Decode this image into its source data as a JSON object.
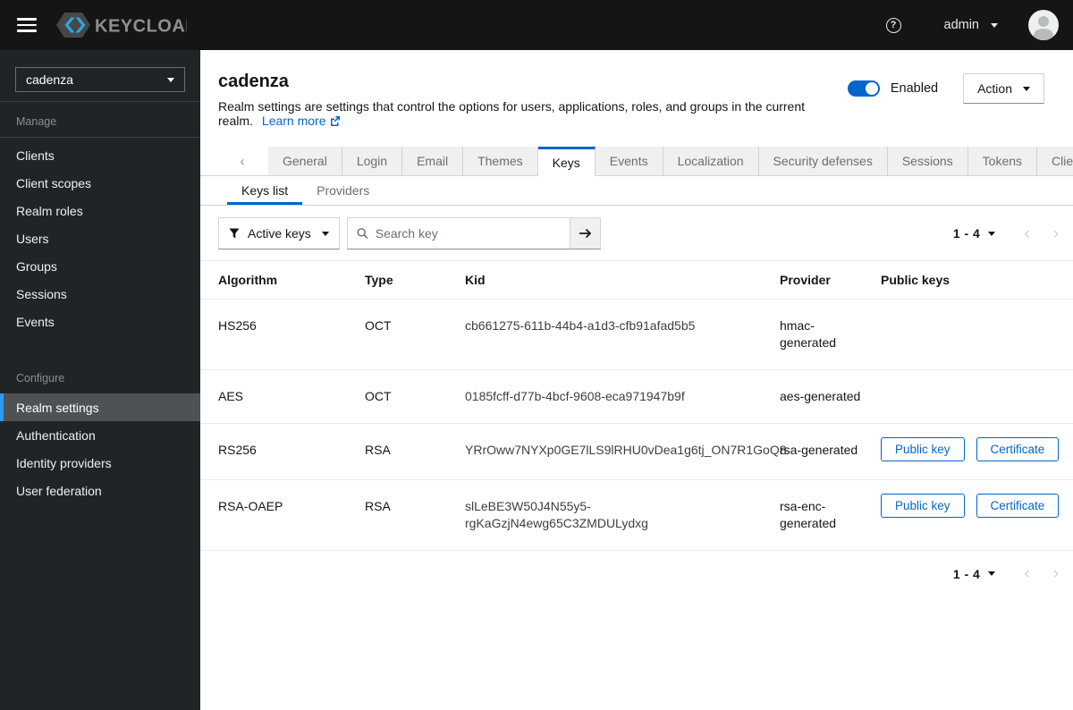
{
  "colors": {
    "accent": "#0066cc",
    "brand_cyan": "#29abe2",
    "topbar_bg": "#151515",
    "sidebar_bg": "#212427",
    "selected_nav_bg": "#4f5255",
    "selected_nav_accent": "#2b9af3",
    "tab_inactive_bg": "#f0f0f0",
    "disabled_gray": "#d2d2d2"
  },
  "topbar": {
    "brand": "KEYCLOAK",
    "help_icon": "?",
    "username": "admin"
  },
  "sidebar": {
    "realm_selector": "cadenza",
    "sections": [
      {
        "title": "Manage",
        "items": [
          "Clients",
          "Client scopes",
          "Realm roles",
          "Users",
          "Groups",
          "Sessions",
          "Events"
        ]
      },
      {
        "title": "Configure",
        "items": [
          "Realm settings",
          "Authentication",
          "Identity providers",
          "User federation"
        ]
      }
    ],
    "active_item": "Realm settings"
  },
  "header": {
    "title": "cadenza",
    "description": "Realm settings are settings that control the options for users, applications, roles, and groups in the current realm.",
    "learn_more": "Learn more",
    "enabled_label": "Enabled",
    "action_label": "Action"
  },
  "tabs": {
    "active": "Keys",
    "items": [
      "General",
      "Login",
      "Email",
      "Themes",
      "Keys",
      "Events",
      "Localization",
      "Security defenses",
      "Sessions",
      "Tokens",
      "Client policies"
    ]
  },
  "subtabs": {
    "active": "Keys list",
    "items": [
      "Keys list",
      "Providers"
    ]
  },
  "toolbar": {
    "filter_label": "Active keys",
    "search_placeholder": "Search key",
    "pagination_range": "1 - 4"
  },
  "table": {
    "columns": [
      "Algorithm",
      "Type",
      "Kid",
      "Provider",
      "Public keys"
    ],
    "rows": [
      {
        "algorithm": "HS256",
        "type": "OCT",
        "kid": "cb661275-611b-44b4-a1d3-cfb91afad5b5",
        "provider": "hmac-generated",
        "actions": []
      },
      {
        "algorithm": "AES",
        "type": "OCT",
        "kid": "0185fcff-d77b-4bcf-9608-eca971947b9f",
        "provider": "aes-generated",
        "actions": []
      },
      {
        "algorithm": "RS256",
        "type": "RSA",
        "kid": "YRrOww7NYXp0GE7lLS9lRHU0vDea1g6tj_ON7R1GoQ8",
        "provider": "rsa-generated",
        "actions": [
          "Public key",
          "Certificate"
        ]
      },
      {
        "algorithm": "RSA-OAEP",
        "type": "RSA",
        "kid": "slLeBE3W50J4N55y5-rgKaGzjN4ewg65C3ZMDULydxg",
        "provider": "rsa-enc-generated",
        "actions": [
          "Public key",
          "Certificate"
        ]
      }
    ]
  },
  "pagination_bottom": {
    "range": "1 - 4"
  }
}
